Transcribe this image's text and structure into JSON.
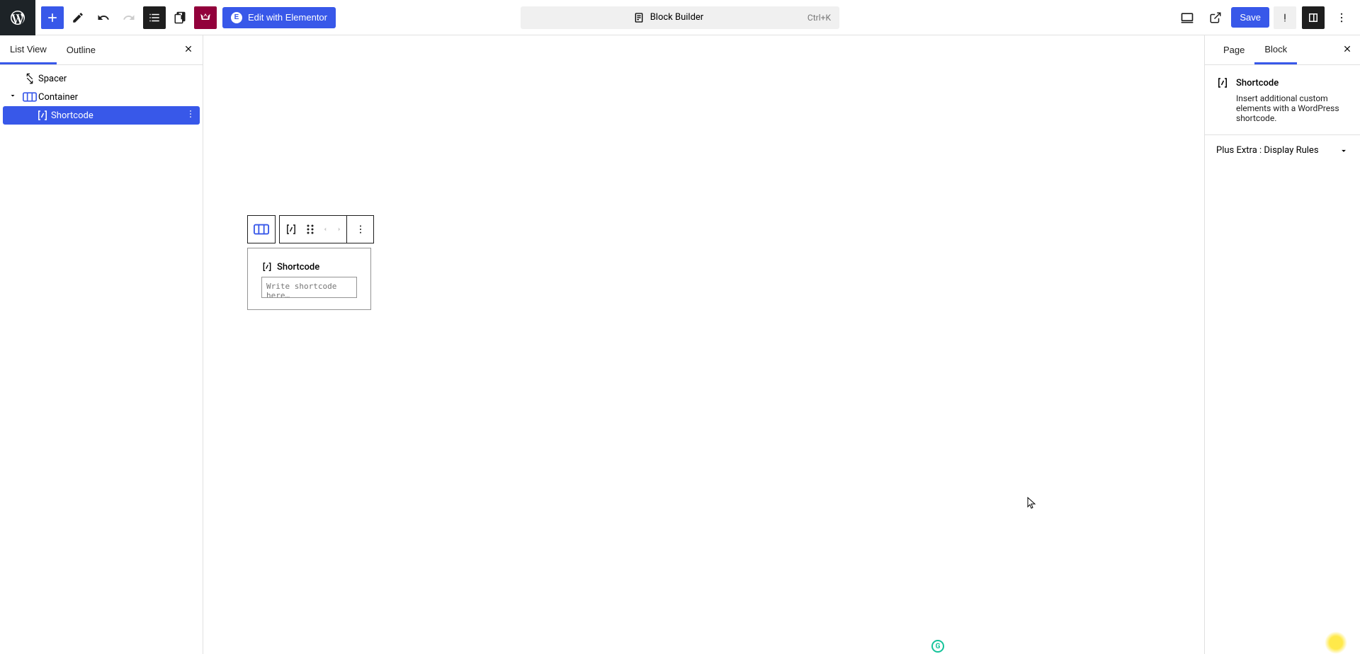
{
  "toolbar": {
    "edit_elementor": "Edit with Elementor",
    "document_title": "Block Builder",
    "shortcut": "Ctrl+K",
    "save": "Save"
  },
  "left_panel": {
    "tabs": {
      "list_view": "List View",
      "outline": "Outline"
    },
    "tree": {
      "spacer": "Spacer",
      "container": "Container",
      "shortcode": "Shortcode"
    }
  },
  "canvas": {
    "shortcode_label": "Shortcode",
    "shortcode_placeholder": "Write shortcode here…"
  },
  "right_panel": {
    "tabs": {
      "page": "Page",
      "block": "Block"
    },
    "block_name": "Shortcode",
    "block_desc": "Insert additional custom elements with a WordPress shortcode.",
    "accordion": "Plus Extra : Display Rules"
  }
}
